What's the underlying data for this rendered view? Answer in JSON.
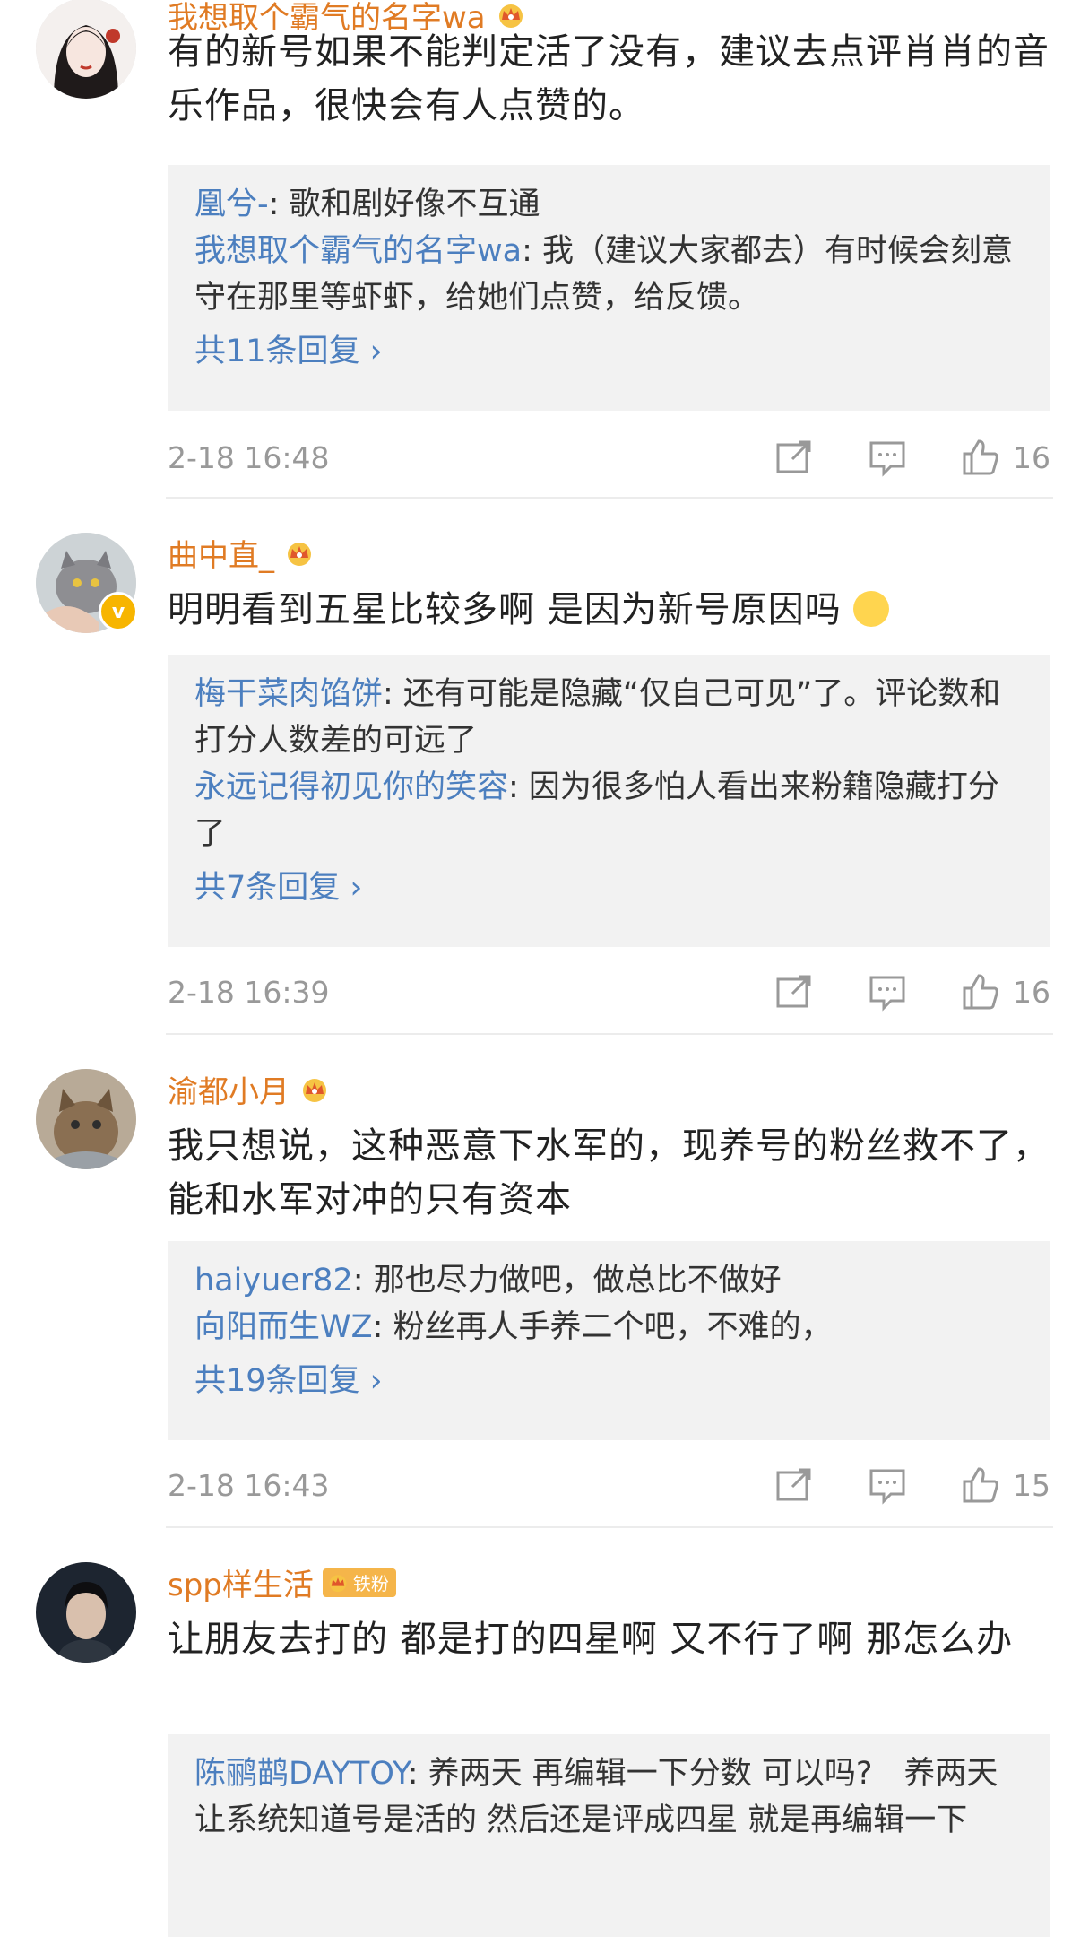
{
  "comments": [
    {
      "username": "我想取个霸气的名字wa",
      "text": "有的新号如果不能判定活了没有，建议去点评肖肖的音乐作品，很快会有人点赞的。",
      "replies": [
        {
          "name": "凰兮-",
          "text": ": 歌和剧好像不互通"
        },
        {
          "name": "我想取个霸气的名字wa",
          "text": ": 我（建议大家都去）有时候会刻意守在那里等虾虾，给她们点赞，给反馈。"
        }
      ],
      "reply_total": "共11条回复 ›",
      "time": "2-18 16:48",
      "likes": "16"
    },
    {
      "username": "曲中直_",
      "text": "明明看到五星比较多啊 是因为新号原因吗",
      "replies": [
        {
          "name": "梅干菜肉馅饼",
          "text": ": 还有可能是隐藏“仅自己可见”了。评论数和打分人数差的可远了"
        },
        {
          "name": "永远记得初见你的笑容",
          "text": ": 因为很多怕人看出来粉籍隐藏打分了"
        }
      ],
      "reply_total": "共7条回复 ›",
      "time": "2-18 16:39",
      "likes": "16"
    },
    {
      "username": "渝都小月",
      "text": "我只想说，这种恶意下水军的，现养号的粉丝救不了，能和水军对冲的只有资本",
      "replies": [
        {
          "name": "haiyuer82",
          "text": ": 那也尽力做吧，做总比不做好"
        },
        {
          "name": "向阳而生WZ",
          "text": ": 粉丝再人手养二个吧，不难的，"
        }
      ],
      "reply_total": "共19条回复 ›",
      "time": "2-18 16:43",
      "likes": "15"
    },
    {
      "username": "spp样生活",
      "badge": "铁粉",
      "text": "让朋友去打的 都是打的四星啊 又不行了啊 那怎么办",
      "replies": [
        {
          "name": "陈鹂鹋DAYTOY",
          "text": ": 养两天 再编辑一下分数 可以吗?　养两天让系统知道号是活的 然后还是评成四星 就是再编辑一下"
        }
      ]
    }
  ],
  "colors": {
    "username": "#e07b24",
    "reply_name": "#4c7fbf",
    "meta": "#999999",
    "reply_bg": "#f2f2f2"
  },
  "icons": [
    "crown-icon",
    "share-icon",
    "comment-icon",
    "like-icon",
    "verified-icon"
  ]
}
